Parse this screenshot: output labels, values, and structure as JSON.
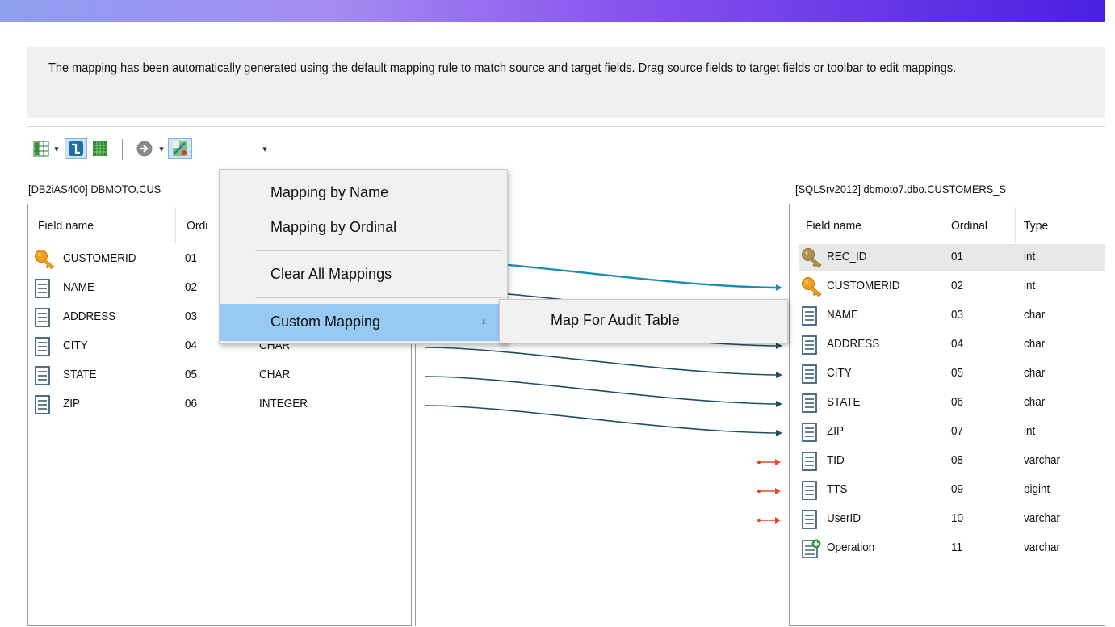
{
  "info": {
    "text": "The mapping has been automatically generated using the default mapping rule to match source and target fields. Drag source fields to target fields or toolbar to edit mappings."
  },
  "toolbar": {
    "icons": [
      "grid-columns-icon",
      "caret-down-icon",
      "mapping-connect-icon",
      "grid-green-icon",
      "arrow-circle-icon",
      "caret-down-icon",
      "auto-map-icon",
      "caret-down-icon"
    ],
    "caret": "▾"
  },
  "source": {
    "title": "[DB2iAS400] DBMOTO.CUS",
    "columns": {
      "field": "Field name",
      "ordinal": "Ordi"
    },
    "rows": [
      {
        "name": "CUSTOMERID",
        "ordinal": "01",
        "type": "",
        "icon": "key-icon"
      },
      {
        "name": "NAME",
        "ordinal": "02",
        "type": "",
        "icon": "field-icon"
      },
      {
        "name": "ADDRESS",
        "ordinal": "03",
        "type": "",
        "icon": "field-icon"
      },
      {
        "name": "CITY",
        "ordinal": "04",
        "type": "CHAR",
        "icon": "field-icon"
      },
      {
        "name": "STATE",
        "ordinal": "05",
        "type": "CHAR",
        "icon": "field-icon"
      },
      {
        "name": "ZIP",
        "ordinal": "06",
        "type": "INTEGER",
        "icon": "field-icon"
      }
    ]
  },
  "target": {
    "title": "[SQLSrv2012] dbmoto7.dbo.CUSTOMERS_S",
    "columns": {
      "field": "Field name",
      "ordinal": "Ordinal",
      "type": "Type"
    },
    "rows": [
      {
        "name": "REC_ID",
        "ordinal": "01",
        "type": "int",
        "icon": "key-gray-icon"
      },
      {
        "name": "CUSTOMERID",
        "ordinal": "02",
        "type": "int",
        "icon": "key-icon"
      },
      {
        "name": "NAME",
        "ordinal": "03",
        "type": "char",
        "icon": "field-icon"
      },
      {
        "name": "ADDRESS",
        "ordinal": "04",
        "type": "char",
        "icon": "field-icon"
      },
      {
        "name": "CITY",
        "ordinal": "05",
        "type": "char",
        "icon": "field-icon"
      },
      {
        "name": "STATE",
        "ordinal": "06",
        "type": "char",
        "icon": "field-icon"
      },
      {
        "name": "ZIP",
        "ordinal": "07",
        "type": "int",
        "icon": "field-icon"
      },
      {
        "name": "TID",
        "ordinal": "08",
        "type": "varchar",
        "icon": "field-icon"
      },
      {
        "name": "TTS",
        "ordinal": "09",
        "type": "bigint",
        "icon": "field-icon"
      },
      {
        "name": "UserID",
        "ordinal": "10",
        "type": "varchar",
        "icon": "field-icon"
      },
      {
        "name": "Operation",
        "ordinal": "11",
        "type": "varchar",
        "icon": "operation-icon"
      }
    ]
  },
  "mappings": [
    {
      "source": "CUSTOMERID",
      "target": "CUSTOMERID"
    },
    {
      "source": "NAME",
      "target": "NAME"
    },
    {
      "source": "ADDRESS",
      "target": "ADDRESS"
    },
    {
      "source": "CITY",
      "target": "CITY"
    },
    {
      "source": "STATE",
      "target": "STATE"
    },
    {
      "source": "ZIP",
      "target": "ZIP"
    }
  ],
  "unmapped": [
    "TID",
    "TTS",
    "UserID"
  ],
  "menu": {
    "items": [
      {
        "label": "Mapping by Name"
      },
      {
        "label": "Mapping by Ordinal"
      },
      {
        "label": "Clear All Mappings"
      },
      {
        "label": "Custom Mapping",
        "submenu": true
      }
    ],
    "submenu_arrow": "›",
    "submenu": [
      {
        "label": "Map For Audit Table"
      }
    ]
  },
  "colors": {
    "mapping_selected": "#1a8fb0",
    "mapping_line": "#1f4f63",
    "unmapped_marker": "#e04a2a",
    "menu_highlight": "#97c9f4"
  }
}
